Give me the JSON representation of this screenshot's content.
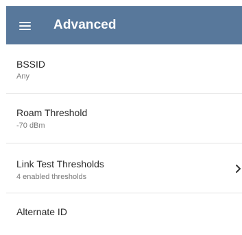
{
  "app_bar": {
    "title": "Advanced",
    "menu_icon": "hamburger-menu-icon",
    "background_color": "#58789b"
  },
  "settings": {
    "items": [
      {
        "title": "BSSID",
        "value": "Any"
      },
      {
        "title": "Roam Threshold",
        "value": "-70 dBm"
      },
      {
        "title": "Link Test Thresholds",
        "value": "4 enabled thresholds",
        "icon": "chevron-right-icon"
      },
      {
        "title": "Alternate ID"
      }
    ]
  }
}
